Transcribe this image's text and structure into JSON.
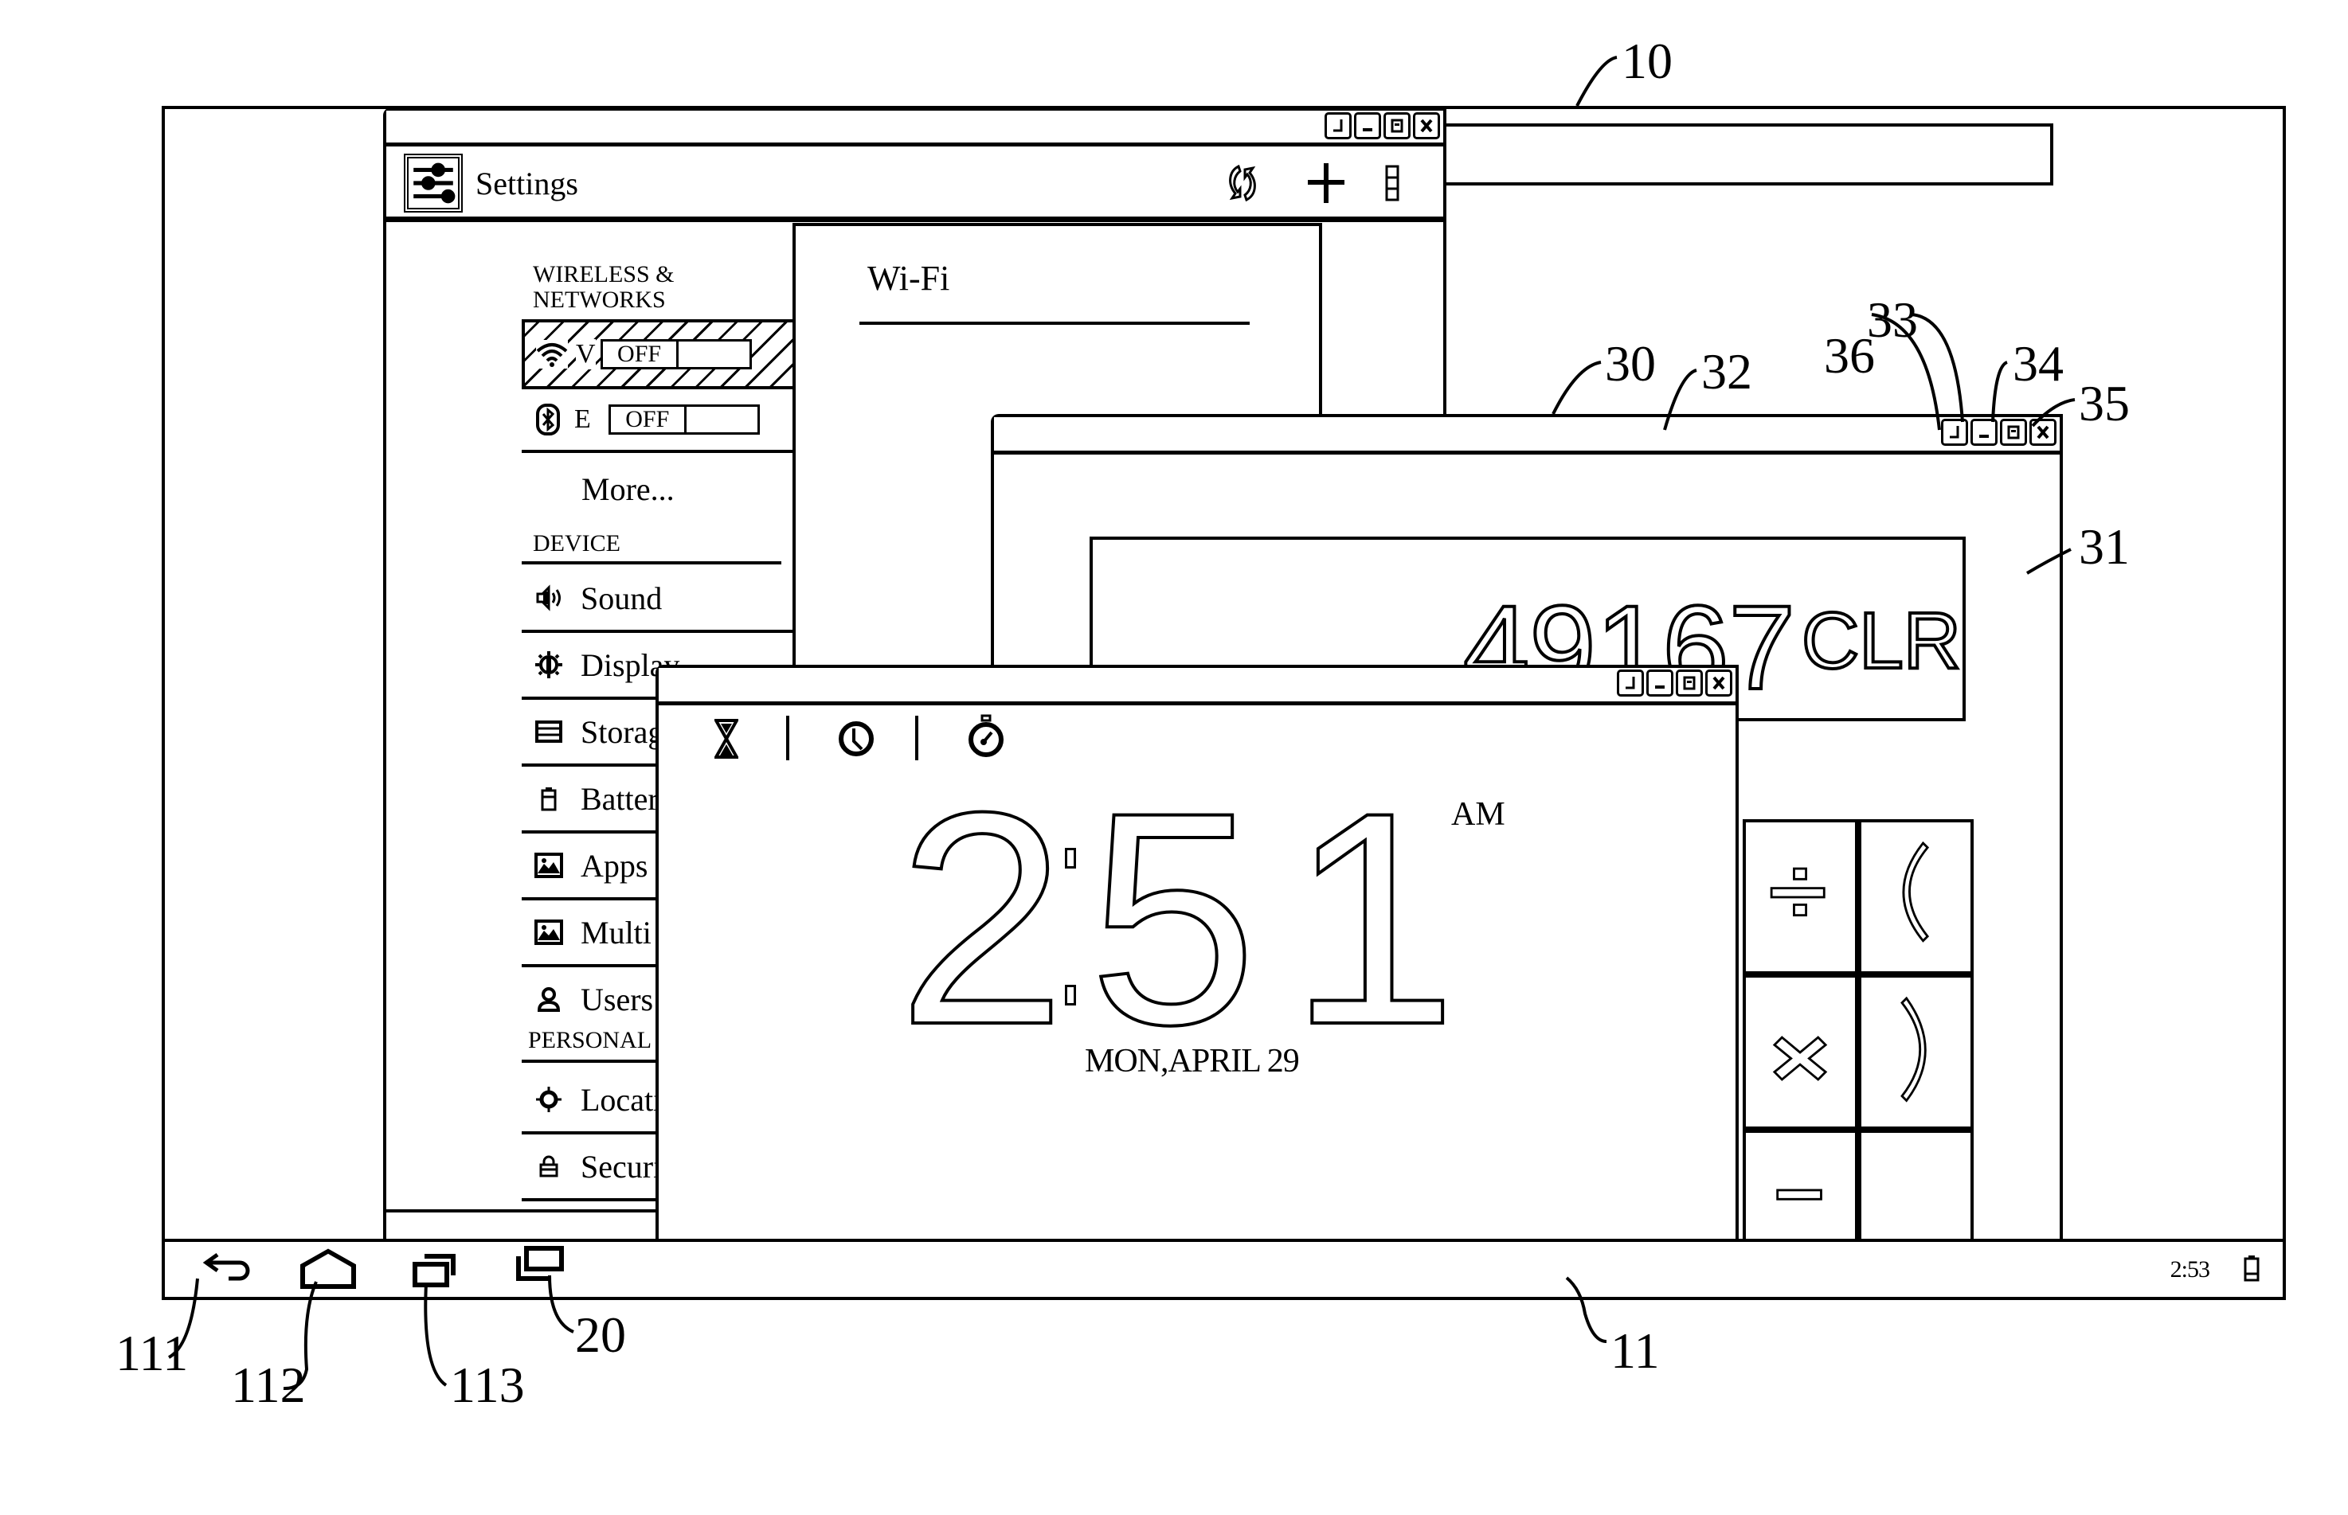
{
  "figure_labels": {
    "screen": "10",
    "taskbar": "11",
    "back": "111",
    "home": "112",
    "recent": "113",
    "multiwindow": "20",
    "window": "30",
    "window_body": "31",
    "title_bar": "32",
    "minimize": "33",
    "maximize": "34",
    "close": "35",
    "resize": "36"
  },
  "settings": {
    "title": "Settings",
    "sections": {
      "wireless": "WIRELESS & NETWORKS",
      "device": "DEVICE",
      "personal": "PERSONAL"
    },
    "wireless_items": [
      {
        "icon": "wifi-icon",
        "label": "V",
        "toggle": "OFF",
        "highlighted": true
      },
      {
        "icon": "bluetooth-icon",
        "label": "E",
        "toggle": "OFF",
        "highlighted": false
      }
    ],
    "more": "More...",
    "device_items": [
      {
        "icon": "sound-icon",
        "label": "Sound"
      },
      {
        "icon": "display-icon",
        "label": "Display"
      },
      {
        "icon": "storage-icon",
        "label": "Storag"
      },
      {
        "icon": "battery-icon",
        "label": "Battery"
      },
      {
        "icon": "apps-icon",
        "label": "Apps"
      },
      {
        "icon": "multi-window-icon",
        "label": "Multi v"
      },
      {
        "icon": "users-icon",
        "label": "Users"
      }
    ],
    "personal_items": [
      {
        "icon": "location-icon",
        "label": "Locati"
      },
      {
        "icon": "security-icon",
        "label": "Securi"
      }
    ],
    "detail_title": "Wi-Fi"
  },
  "calculator": {
    "display": "49167",
    "clear": "CLR",
    "buttons": [
      "÷",
      "(",
      "×",
      ")",
      "−",
      ""
    ]
  },
  "clock": {
    "tabs": [
      "timer-icon",
      "clock-icon",
      "stopwatch-icon"
    ],
    "hour": "2",
    "minutes": "51",
    "ampm": "AM",
    "date": "MON,APRIL 29"
  },
  "taskbar": {
    "time": "2:53"
  }
}
